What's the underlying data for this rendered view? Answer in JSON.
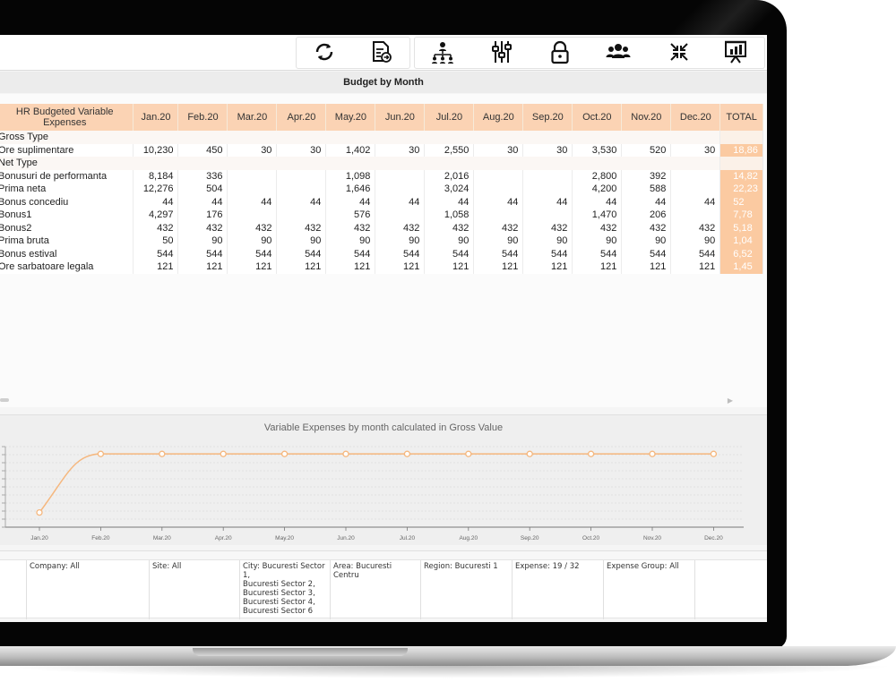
{
  "toolbar": {
    "buttons": [
      "refresh-icon",
      "export-report-icon",
      "hierarchy-icon",
      "sliders-icon",
      "lock-icon",
      "users-group-icon",
      "collapse-arrows-icon",
      "presentation-chart-icon"
    ]
  },
  "report": {
    "title": "Budget by Month"
  },
  "table": {
    "header_label": "HR Budgeted Variable Expenses",
    "months": [
      "Jan.20",
      "Feb.20",
      "Mar.20",
      "Apr.20",
      "May.20",
      "Jun.20",
      "Jul.20",
      "Aug.20",
      "Sep.20",
      "Oct.20",
      "Nov.20",
      "Dec.20"
    ],
    "total_label": "TOTAL",
    "groups": [
      {
        "name": "Gross Type",
        "rows": [
          {
            "label": "Ore suplimentare",
            "values": [
              "10,230",
              "450",
              "30",
              "30",
              "1,402",
              "30",
              "2,550",
              "30",
              "30",
              "3,530",
              "520",
              "30"
            ],
            "total": "18,86"
          }
        ]
      },
      {
        "name": "Net Type",
        "rows": [
          {
            "label": "Bonusuri de performanta",
            "values": [
              "8,184",
              "336",
              "",
              "",
              "1,098",
              "",
              "2,016",
              "",
              "",
              "2,800",
              "392",
              ""
            ],
            "total": "14,82"
          },
          {
            "label": "Prima neta",
            "values": [
              "12,276",
              "504",
              "",
              "",
              "1,646",
              "",
              "3,024",
              "",
              "",
              "4,200",
              "588",
              ""
            ],
            "total": "22,23"
          },
          {
            "label": "Bonus concediu",
            "values": [
              "44",
              "44",
              "44",
              "44",
              "44",
              "44",
              "44",
              "44",
              "44",
              "44",
              "44",
              "44"
            ],
            "total": "52"
          },
          {
            "label": "Bonus1",
            "values": [
              "4,297",
              "176",
              "",
              "",
              "576",
              "",
              "1,058",
              "",
              "",
              "1,470",
              "206",
              ""
            ],
            "total": "7,78"
          },
          {
            "label": "Bonus2",
            "values": [
              "432",
              "432",
              "432",
              "432",
              "432",
              "432",
              "432",
              "432",
              "432",
              "432",
              "432",
              "432"
            ],
            "total": "5,18"
          },
          {
            "label": "Prima bruta",
            "values": [
              "50",
              "90",
              "90",
              "90",
              "90",
              "90",
              "90",
              "90",
              "90",
              "90",
              "90",
              "90"
            ],
            "total": "1,04"
          },
          {
            "label": "Bonus estival",
            "values": [
              "544",
              "544",
              "544",
              "544",
              "544",
              "544",
              "544",
              "544",
              "544",
              "544",
              "544",
              "544"
            ],
            "total": "6,52"
          },
          {
            "label": "Ore sarbatoare legala",
            "values": [
              "121",
              "121",
              "121",
              "121",
              "121",
              "121",
              "121",
              "121",
              "121",
              "121",
              "121",
              "121"
            ],
            "total": "1,45"
          }
        ]
      }
    ]
  },
  "chart": {
    "title": "Variable Expenses by month calculated in Gross Value",
    "line_color": "#f5b77e"
  },
  "chart_data": {
    "type": "line",
    "title": "Variable Expenses by month calculated in Gross Value",
    "categories": [
      "Jan.20",
      "Feb.20",
      "Mar.20",
      "Apr.20",
      "May.20",
      "Jun.20",
      "Jul.20",
      "Aug.20",
      "Sep.20",
      "Oct.20",
      "Nov.20",
      "Dec.20"
    ],
    "values": [
      0.2,
      1,
      1,
      1,
      1,
      1,
      1,
      1,
      1,
      1,
      1,
      1
    ],
    "ylim": [
      0,
      1.1
    ],
    "grid": true
  },
  "filters": [
    "",
    "Company: All",
    "Site: All",
    "City: Bucuresti Sector 1,\nBucuresti Sector 2,\nBucuresti Sector 3,\nBucuresti Sector 4,\nBucuresti Sector 6",
    "Area: Bucuresti Centru",
    "Region: Bucuresti 1",
    "Expense: 19 / 32",
    "Expense Group: All",
    ""
  ]
}
